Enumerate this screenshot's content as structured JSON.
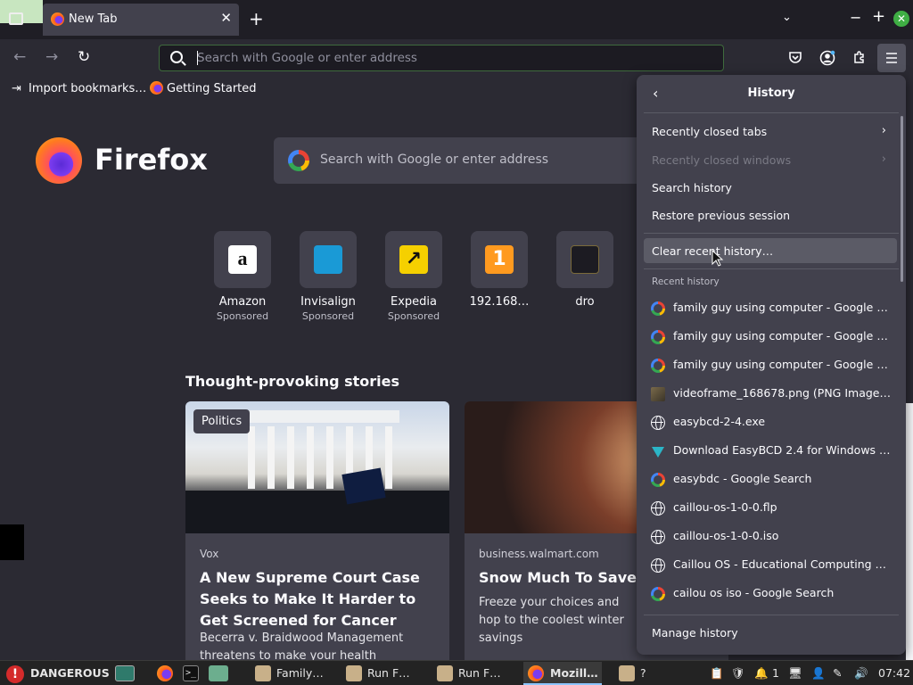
{
  "window": {
    "tab_title": "New Tab",
    "tab_close": "✕",
    "new_tab": "+",
    "list_tabs": "⌄",
    "minimize": "−",
    "maximize": "+",
    "close": "✕"
  },
  "nav": {
    "back": "←",
    "forward": "→",
    "reload": "↻",
    "url_placeholder": "Search with Google or enter address"
  },
  "bookmarks": [
    {
      "label": "Import bookmarks…"
    },
    {
      "label": "Getting Started"
    }
  ],
  "newtab": {
    "brand": "Firefox",
    "search_placeholder": "Search with Google or enter address",
    "top_sites": [
      {
        "name": "Amazon",
        "sponsored": "Sponsored",
        "icon": "amazon-logo",
        "color": "#ffffff"
      },
      {
        "name": "Invisalign",
        "sponsored": "Sponsored",
        "icon": "invisalign-logo",
        "color": "#1a9ad6"
      },
      {
        "name": "Expedia",
        "sponsored": "Sponsored",
        "icon": "expedia-logo",
        "color": "#f5d000"
      },
      {
        "name": "192.168…",
        "sponsored": "",
        "icon": "number-one-icon",
        "color": "#ff9a1f"
      },
      {
        "name": "dro",
        "sponsored": "",
        "icon": "boot-icon",
        "color": "#2b2a33"
      }
    ],
    "stories_heading": "Thought-provoking stories",
    "stories": [
      {
        "badge": "Politics",
        "source": "Vox",
        "title": "A New Supreme Court Case Seeks to Make It Harder to Get Screened for Cancer",
        "excerpt": "Becerra v. Braidwood Management threatens to make your health insurance"
      },
      {
        "source": "business.walmart.com",
        "title": "Snow Much To Save",
        "excerpt": "Freeze your choices and hop to the coolest winter savings"
      }
    ]
  },
  "history_panel": {
    "back": "‹",
    "title": "History",
    "items": [
      {
        "label": "Recently closed tabs",
        "disabled": false,
        "has_sub": true
      },
      {
        "label": "Recently closed windows",
        "disabled": true,
        "has_sub": true
      },
      {
        "label": "Search history",
        "disabled": false
      },
      {
        "label": "Restore previous session",
        "disabled": false
      }
    ],
    "clear": "Clear recent history…",
    "recent_label": "Recent history",
    "recent": [
      {
        "text": "family guy using computer - Google Se…",
        "icon": "google-icon"
      },
      {
        "text": "family guy using computer - Google Se…",
        "icon": "google-icon"
      },
      {
        "text": "family guy using computer - Google Se…",
        "icon": "google-icon"
      },
      {
        "text": "videoframe_168678.png (PNG Image, …",
        "icon": "image-icon"
      },
      {
        "text": "easybcd-2-4.exe",
        "icon": "globe-icon"
      },
      {
        "text": "Download EasyBCD 2.4 for Windows | …",
        "icon": "easybcd-icon"
      },
      {
        "text": "easybdc - Google Search",
        "icon": "google-icon"
      },
      {
        "text": "caillou-os-1-0-0.flp",
        "icon": "globe-icon"
      },
      {
        "text": "caillou-os-1-0-0.iso",
        "icon": "globe-icon"
      },
      {
        "text": "Caillou OS - Educational Computing En…",
        "icon": "globe-icon"
      },
      {
        "text": "cailou os iso - Google Search",
        "icon": "google-icon"
      }
    ],
    "manage": "Manage history"
  },
  "taskbar": {
    "warning": "DANGEROUS",
    "apps": [
      {
        "label": "Family…"
      },
      {
        "label": "Run F…"
      },
      {
        "label": "Run F…"
      },
      {
        "label": "Mozill…"
      },
      {
        "label": "?"
      }
    ],
    "tray_count": "1",
    "clock": "07:42"
  }
}
